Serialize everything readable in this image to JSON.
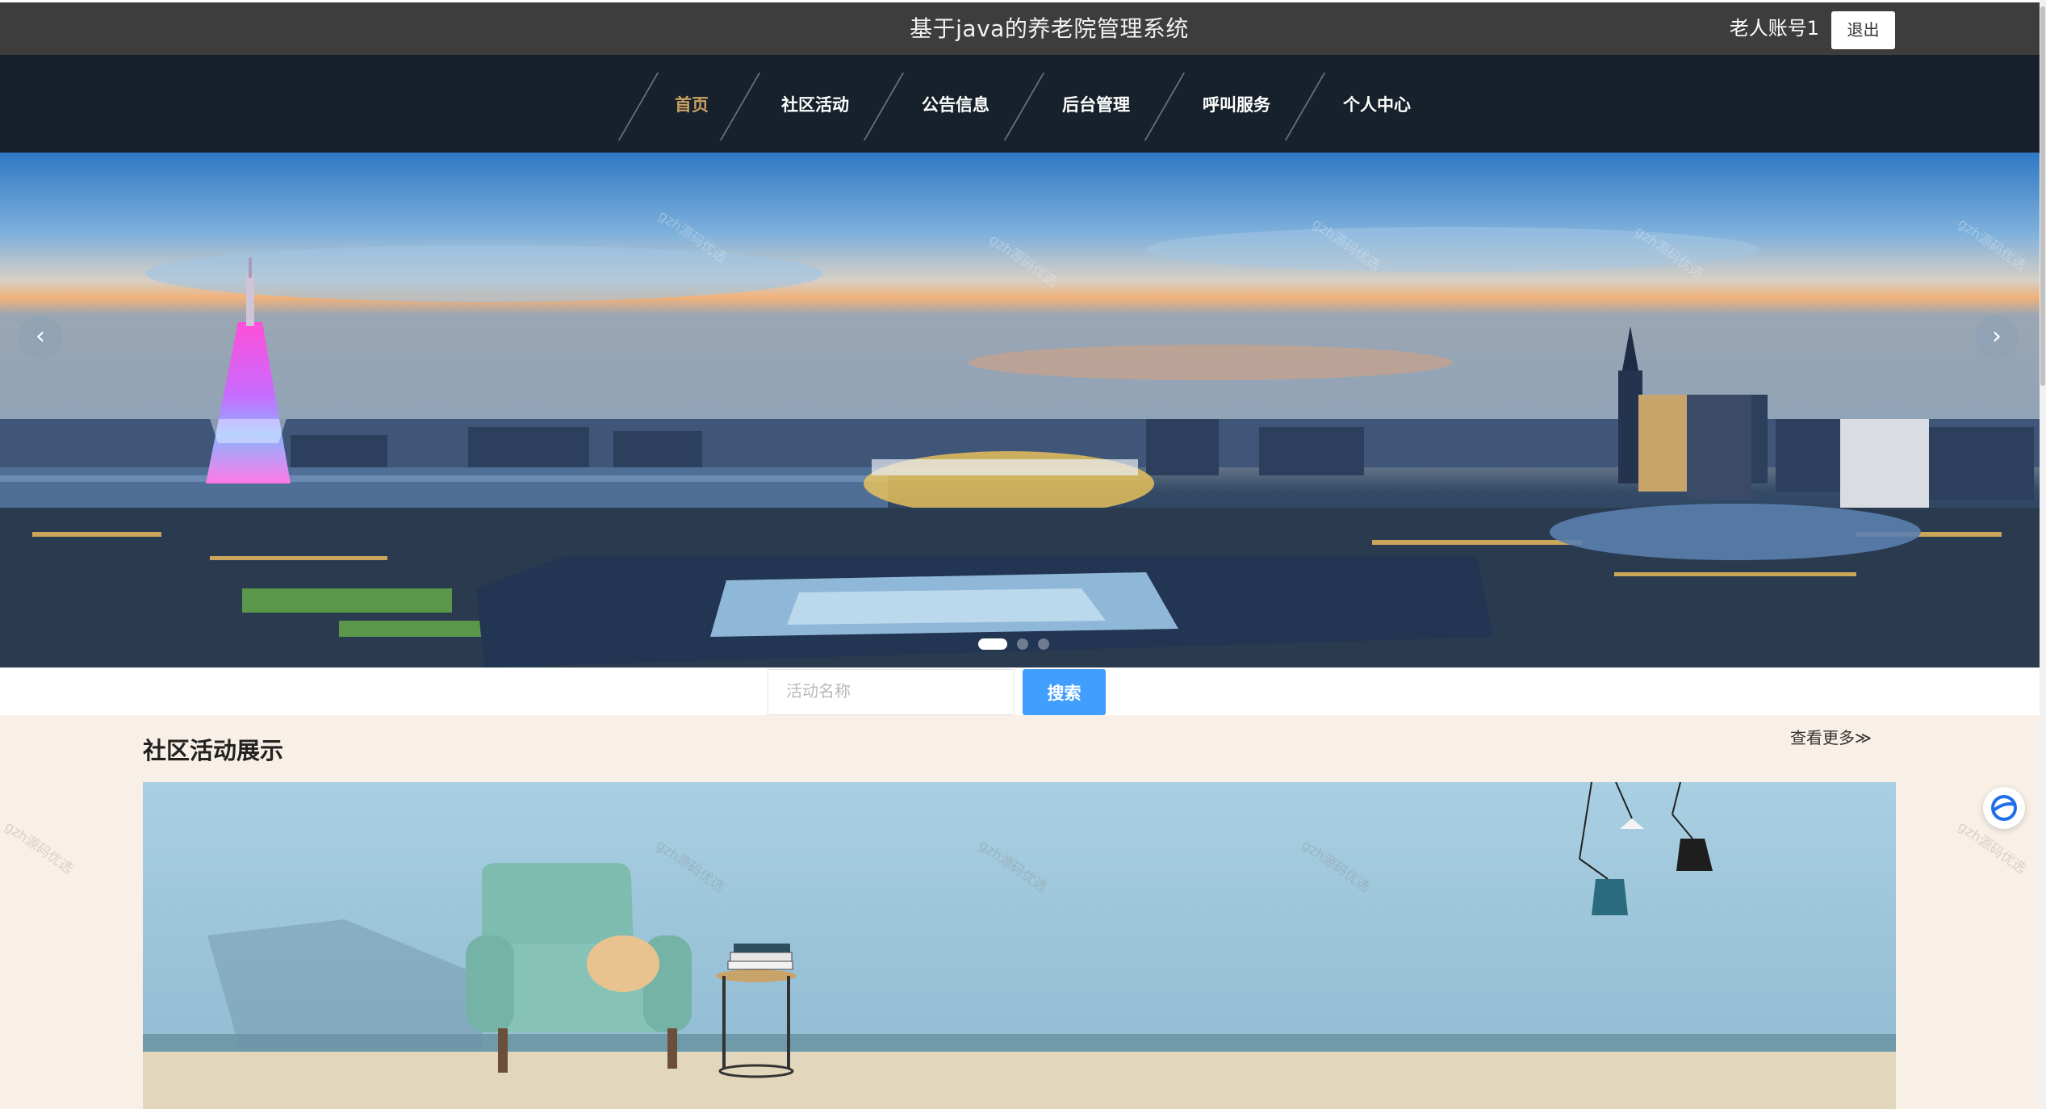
{
  "header": {
    "title": "基于java的养老院管理系统",
    "account": "老人账号1",
    "logout_label": "退出"
  },
  "nav": {
    "items": [
      {
        "label": "首页",
        "active": true
      },
      {
        "label": "社区活动",
        "active": false
      },
      {
        "label": "公告信息",
        "active": false
      },
      {
        "label": "后台管理",
        "active": false
      },
      {
        "label": "呼叫服务",
        "active": false
      },
      {
        "label": "个人中心",
        "active": false
      }
    ],
    "active_color": "#c9a063"
  },
  "banner": {
    "prev_label": "‹",
    "next_label": "›",
    "slide_count": 3,
    "current_slide": 1
  },
  "search": {
    "placeholder": "活动名称",
    "value": "",
    "button_label": "搜索"
  },
  "activity_section": {
    "title": "社区活动展示",
    "more_label": "查看更多≫"
  },
  "watermark": "gzh源码优选",
  "colors": {
    "topbar": "#3d3d3d",
    "navbar": "#17212b",
    "primary_button": "#409eff",
    "section_background": "#f8efe6"
  }
}
